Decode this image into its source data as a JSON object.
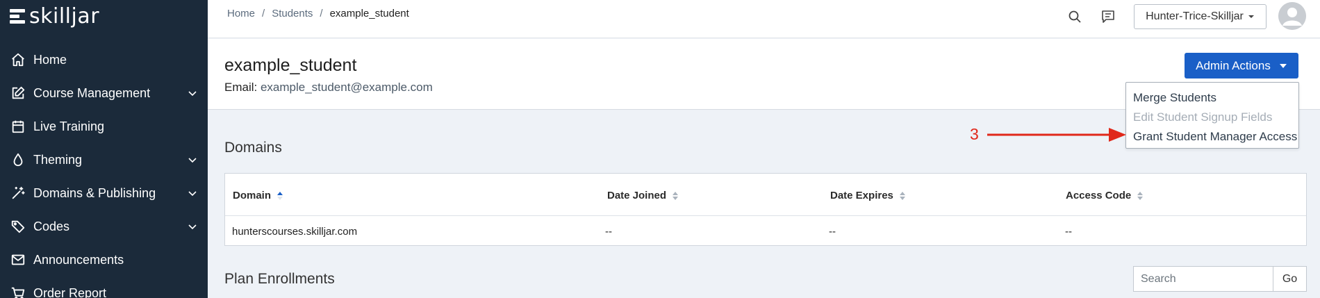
{
  "sidebar": {
    "logo_text": "skilljar",
    "items": [
      {
        "label": "Home",
        "icon": "home-icon",
        "expandable": false
      },
      {
        "label": "Course Management",
        "icon": "edit-icon",
        "expandable": true
      },
      {
        "label": "Live Training",
        "icon": "calendar-icon",
        "expandable": false
      },
      {
        "label": "Theming",
        "icon": "droplet-icon",
        "expandable": true
      },
      {
        "label": "Domains & Publishing",
        "icon": "magic-wand-icon",
        "expandable": true
      },
      {
        "label": "Codes",
        "icon": "tags-icon",
        "expandable": true
      },
      {
        "label": "Announcements",
        "icon": "mail-icon",
        "expandable": false
      },
      {
        "label": "Order Report",
        "icon": "cart-icon",
        "expandable": false
      }
    ]
  },
  "topbar": {
    "breadcrumb": [
      "Home",
      "Students",
      "example_student"
    ],
    "user_label": "Hunter-Trice-Skilljar"
  },
  "header": {
    "student_name": "example_student",
    "email_label": "Email:",
    "email_value": "example_student@example.com",
    "admin_actions_label": "Admin Actions"
  },
  "dropdown": {
    "items": [
      {
        "label": "Merge Students",
        "disabled": false
      },
      {
        "label": "Edit Student Signup Fields",
        "disabled": true
      },
      {
        "label": "Grant Student Manager Access",
        "disabled": false
      }
    ]
  },
  "annotation": {
    "number": "3",
    "color": "#e0281a"
  },
  "domains": {
    "title": "Domains",
    "columns": [
      "Domain",
      "Date Joined",
      "Date Expires",
      "Access Code"
    ],
    "rows": [
      [
        "hunterscourses.skilljar.com",
        "--",
        "--",
        "--"
      ]
    ]
  },
  "plan_enrollments": {
    "title": "Plan Enrollments",
    "search_placeholder": "Search",
    "go_label": "Go"
  },
  "colors": {
    "sidebar_bg": "#1b2a3a",
    "primary": "#1a5fc7",
    "page_bg": "#eef2f7"
  }
}
